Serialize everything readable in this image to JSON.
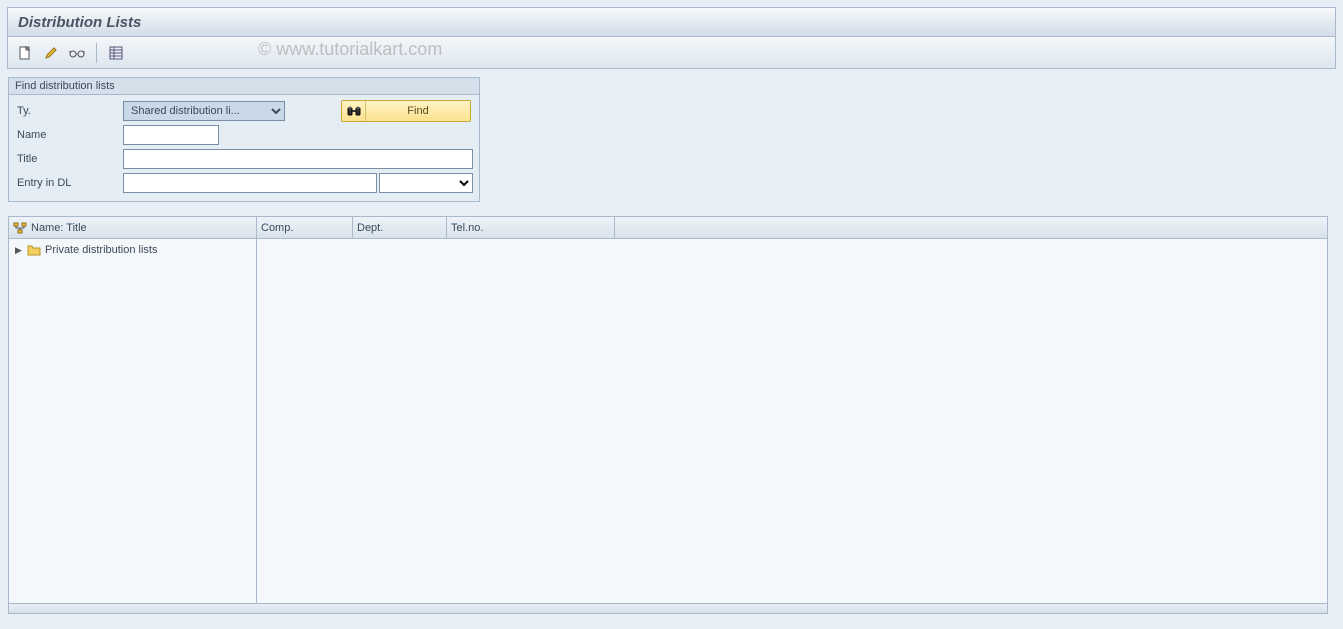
{
  "header": {
    "title": "Distribution Lists"
  },
  "watermark": "© www.tutorialkart.com",
  "toolbar": {
    "icons": {
      "create": "create-icon",
      "edit": "edit-icon",
      "display": "display-icon",
      "layout": "layout-icon"
    }
  },
  "find_panel": {
    "title": "Find distribution lists",
    "labels": {
      "ty": "Ty.",
      "name": "Name",
      "title": "Title",
      "entry": "Entry in DL"
    },
    "ty_value": "Shared distribution li...",
    "name_value": "",
    "title_value": "",
    "entry_value": "",
    "entry_select_value": "",
    "find_button_label": "Find"
  },
  "grid": {
    "columns": {
      "name_title": "Name: Title",
      "comp": "Comp.",
      "dept": "Dept.",
      "tel": "Tel.no."
    },
    "rows": [
      {
        "label": "Private distribution lists"
      }
    ]
  }
}
